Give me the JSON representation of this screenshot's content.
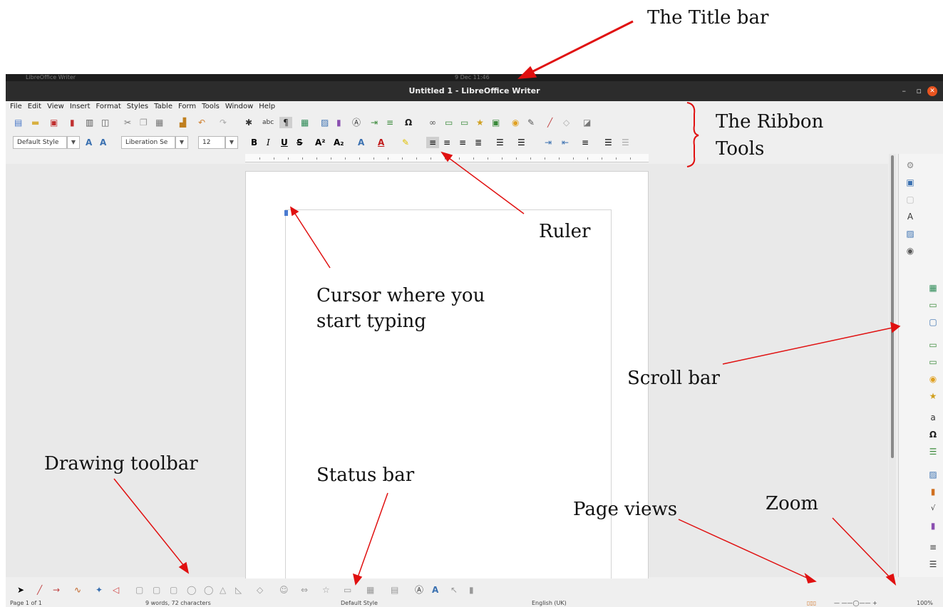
{
  "window": {
    "title": "Untitled 1 - LibreOffice Writer",
    "top_left_app": "LibreOffice Writer",
    "top_clock": "9 Dec 11:46",
    "minimize": "–",
    "restore": "▫",
    "close": "✕"
  },
  "menus": [
    "File",
    "Edit",
    "View",
    "Insert",
    "Format",
    "Styles",
    "Table",
    "Form",
    "Tools",
    "Window",
    "Help"
  ],
  "formatting": {
    "style_value": "Default Style",
    "font_value": "Liberation Se",
    "size_value": "12",
    "bold": "B",
    "italic": "I",
    "underline": "U",
    "strike": "S",
    "superscript": "A²",
    "subscript": "A₂"
  },
  "status_bar": {
    "page": "Page 1 of 1",
    "words": "9 words, 72 characters",
    "style": "Default Style",
    "language": "English (UK)",
    "zoom": "100%"
  },
  "annotations": {
    "title_bar": "The Title bar",
    "ribbon_line1": "The Ribbon",
    "ribbon_line2": "Tools",
    "ruler": "Ruler",
    "cursor_line1": "Cursor where you",
    "cursor_line2": "start typing",
    "scroll_bar": "Scroll bar",
    "drawing_toolbar": "Drawing toolbar",
    "status_bar": "Status bar",
    "page_views": "Page views",
    "zoom": "Zoom"
  },
  "colors": {
    "arrow": "#e01010",
    "title_bg": "#2c2c2c",
    "close_button": "#e9541f"
  }
}
